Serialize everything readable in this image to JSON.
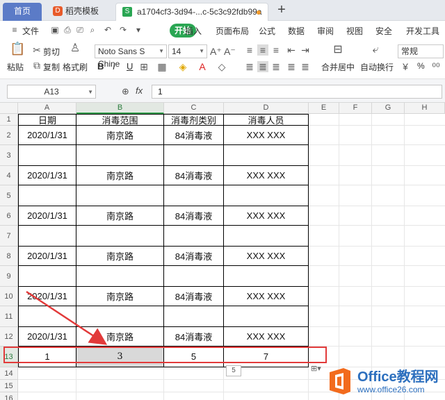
{
  "tabs": {
    "home": "首页",
    "docer": "稻壳模板",
    "active": "a1704cf3-3d94-...c-5c3c92fdb99a",
    "add": "+"
  },
  "menu": {
    "file": "文件",
    "start": "开始",
    "insert": "插入",
    "page_layout": "页面布局",
    "formula": "公式",
    "data": "数据",
    "review": "审阅",
    "view": "视图",
    "security": "安全",
    "dev_tools": "开发工具"
  },
  "toolbar": {
    "paste": "粘贴",
    "cut": "剪切",
    "copy": "复制",
    "format_painter": "格式刷",
    "font_name": "Noto Sans S Chine",
    "font_size": "14",
    "bold": "B",
    "italic": "I",
    "underline": "U",
    "merge_center": "合并居中",
    "auto_wrap": "自动换行",
    "number_format": "常规",
    "percent": "%"
  },
  "formula_bar": {
    "name_box": "A13",
    "fx": "fx",
    "value": "1"
  },
  "columns": [
    "A",
    "B",
    "C",
    "D",
    "E",
    "F",
    "G",
    "H"
  ],
  "rows": [
    "1",
    "2",
    "3",
    "4",
    "5",
    "6",
    "7",
    "8",
    "9",
    "10",
    "11",
    "12",
    "13",
    "14",
    "15",
    "16"
  ],
  "table": {
    "headers": [
      "日期",
      "消毒范围",
      "消毒剂类别",
      "消毒人员"
    ],
    "data_rows": [
      [
        "2020/1/31",
        "南京路",
        "84消毒液",
        "XXX XXX"
      ],
      [
        "",
        "",
        "",
        ""
      ],
      [
        "2020/1/31",
        "南京路",
        "84消毒液",
        "XXX XXX"
      ],
      [
        "",
        "",
        "",
        ""
      ],
      [
        "2020/1/31",
        "南京路",
        "84消毒液",
        "XXX XXX"
      ],
      [
        "",
        "",
        "",
        ""
      ],
      [
        "2020/1/31",
        "南京路",
        "84消毒液",
        "XXX XXX"
      ],
      [
        "",
        "",
        "",
        ""
      ],
      [
        "2020/1/31",
        "南京路",
        "84消毒液",
        "XXX XXX"
      ],
      [
        "",
        "",
        "",
        ""
      ],
      [
        "2020/1/31",
        "南京路",
        "84消毒液",
        "XXX XXX"
      ],
      [
        "1",
        "3",
        "5",
        "7"
      ]
    ]
  },
  "selection_sum": "5",
  "watermark": {
    "title": "Office教程网",
    "url": "www.office26.com"
  },
  "colors": {
    "accent": "#2aa653",
    "highlight": "#e23a3a",
    "watermark": "#2c6fbe"
  }
}
